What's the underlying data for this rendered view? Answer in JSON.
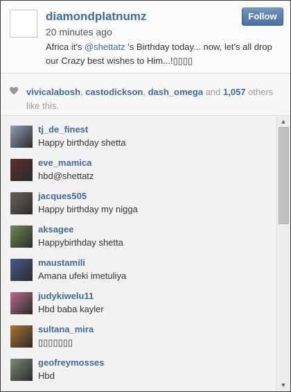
{
  "post": {
    "username": "diamondplatnumz",
    "timestamp": "20 minutes ago",
    "caption_before": "Africa it's ",
    "caption_mention": "@shettatz",
    "caption_after": " 's Birthday today... now, let's all drop our Crazy best wishes to Him...!▯▯▯▯",
    "follow_label": "Follow"
  },
  "likes": {
    "users": [
      "vivicalabosh",
      "castodickson",
      "dash_omega"
    ],
    "sep1": ", ",
    "sep2": ", ",
    "and_word": " and ",
    "count": "1,057",
    "suffix": " others like this."
  },
  "comments": [
    {
      "user": "tj_de_finest",
      "text": "Happy birthday shetta",
      "avatar_color": "#8fa0b8"
    },
    {
      "user": "eve_mamica",
      "text": "hbd@shettatz",
      "avatar_color": "#5a2f2a"
    },
    {
      "user": "jacques505",
      "text": "Happy birthday my nigga",
      "avatar_color": "#6b6258"
    },
    {
      "user": "aksagee",
      "text": "Happybirthday shetta",
      "avatar_color": "#6e8a56"
    },
    {
      "user": "maustamili",
      "text": "Amana ufeki imetuliya",
      "avatar_color": "#4a5a8a"
    },
    {
      "user": "judykiwelu11",
      "text": "Hbd baba kayler",
      "avatar_color": "#b96a8a"
    },
    {
      "user": "sultana_mira",
      "text": "▯▯▯▯▯▯▯",
      "avatar_color": "#a8742e"
    },
    {
      "user": "geofreymosses",
      "text": "Hbd",
      "avatar_color": "#7d8a78"
    }
  ],
  "icons": {
    "heart": "heart-icon",
    "scroll_up": "▲",
    "scroll_down": "▼"
  }
}
